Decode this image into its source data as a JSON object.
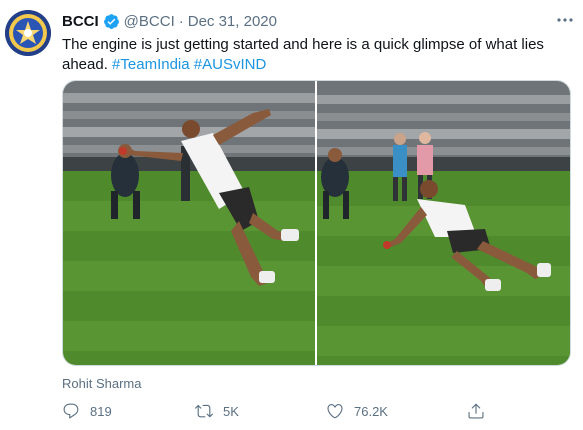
{
  "tweet": {
    "author_name": "BCCI",
    "handle": "@BCCI",
    "separator": "·",
    "date": "Dec 31, 2020",
    "text_plain": "The engine is just getting started and here is a quick glimpse of what lies ahead. ",
    "hashtags": [
      "#TeamIndia",
      "#AUSvIND"
    ],
    "media_caption": "Rohit Sharma",
    "verified": true,
    "more_icon": "more-horizontal-icon"
  },
  "actions": {
    "reply_count": "819",
    "retweet_count": "5K",
    "like_count": "76.2K"
  },
  "colors": {
    "accent": "#1b95e0",
    "muted": "#5b7083",
    "verified": "#1da1f2"
  }
}
